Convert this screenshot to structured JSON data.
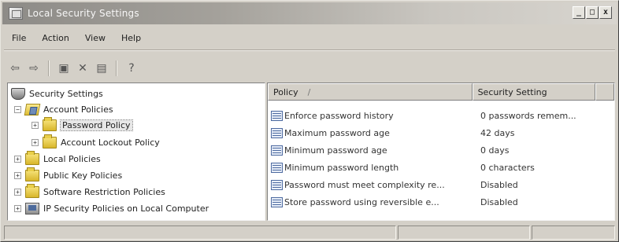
{
  "window": {
    "title": "Local Security Settings",
    "controls": {
      "minimize": "_",
      "restore": "□",
      "close": "x"
    }
  },
  "menu": [
    "File",
    "Action",
    "View",
    "Help"
  ],
  "toolbar": {
    "buttons": [
      "back-arrow-icon",
      "forward-arrow-icon",
      "up-folder-icon",
      "delete-icon",
      "export-list-icon",
      "help-icon"
    ],
    "glyphs": {
      "back": "⇦",
      "forward": "⇨",
      "up": "▣",
      "delete": "✕",
      "export": "▤",
      "help": "?"
    }
  },
  "tree": [
    {
      "label": "Security Settings",
      "level": 0,
      "expander": "",
      "icon": "shield-icon"
    },
    {
      "label": "Account Policies",
      "level": 1,
      "expander": "−",
      "icon": "open-folder-icon"
    },
    {
      "label": "Password Policy",
      "level": 2,
      "expander": "+",
      "icon": "folder-icon",
      "selected": true
    },
    {
      "label": "Account Lockout Policy",
      "level": 2,
      "expander": "+",
      "icon": "folder-icon"
    },
    {
      "label": "Local Policies",
      "level": 1,
      "expander": "+",
      "icon": "folder-icon"
    },
    {
      "label": "Public Key Policies",
      "level": 1,
      "expander": "+",
      "icon": "folder-icon"
    },
    {
      "label": "Software Restriction Policies",
      "level": 1,
      "expander": "+",
      "icon": "folder-icon"
    },
    {
      "label": "IP Security Policies on Local Computer",
      "level": 1,
      "expander": "+",
      "icon": "computer-icon"
    }
  ],
  "list": {
    "columns": [
      "Policy",
      "Security Setting"
    ],
    "sort_indicator": "/",
    "rows": [
      {
        "policy": "Enforce password history",
        "setting": "0 passwords remem..."
      },
      {
        "policy": "Maximum password age",
        "setting": "42 days"
      },
      {
        "policy": "Minimum password age",
        "setting": "0 days"
      },
      {
        "policy": "Minimum password length",
        "setting": "0 characters"
      },
      {
        "policy": "Password must meet complexity re...",
        "setting": "Disabled"
      },
      {
        "policy": "Store password using reversible e...",
        "setting": "Disabled"
      }
    ]
  },
  "status": [
    "",
    "",
    ""
  ]
}
